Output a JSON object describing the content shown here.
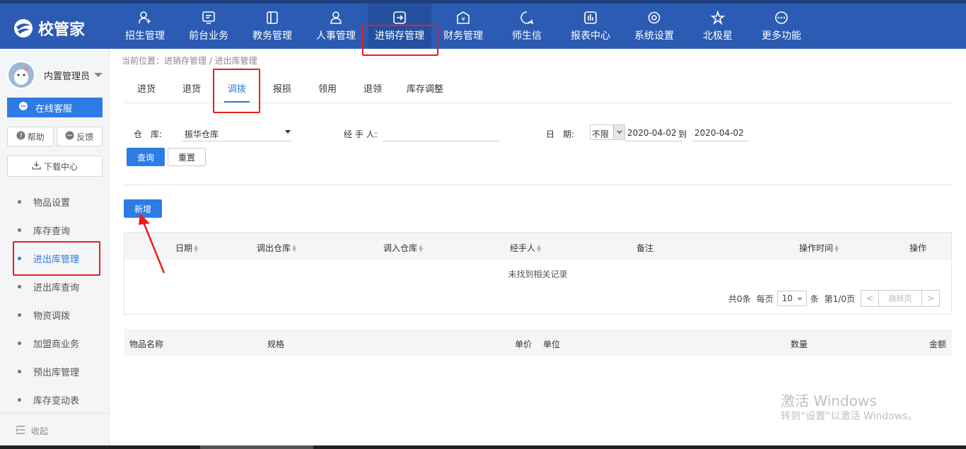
{
  "app": {
    "logo_text": "校管家"
  },
  "nav": [
    {
      "label": "招生管理",
      "icon": "person-add-icon"
    },
    {
      "label": "前台业务",
      "icon": "monitor-icon"
    },
    {
      "label": "教务管理",
      "icon": "book-icon"
    },
    {
      "label": "人事管理",
      "icon": "person-icon"
    },
    {
      "label": "进销存管理",
      "icon": "inventory-icon",
      "active": true
    },
    {
      "label": "财务管理",
      "icon": "yen-icon"
    },
    {
      "label": "师生信",
      "icon": "chat-icon"
    },
    {
      "label": "报表中心",
      "icon": "report-icon"
    },
    {
      "label": "系统设置",
      "icon": "settings-icon"
    },
    {
      "label": "北极星",
      "icon": "star-icon"
    },
    {
      "label": "更多功能",
      "icon": "more-icon"
    }
  ],
  "sidebar": {
    "user_name": "内置管理员",
    "online_service": "在线客服",
    "help": "帮助",
    "feedback": "反馈",
    "download_center": "下载中心",
    "items": [
      {
        "label": "物品设置"
      },
      {
        "label": "库存查询"
      },
      {
        "label": "进出库管理",
        "active": true
      },
      {
        "label": "进出库查询"
      },
      {
        "label": "物资调拨"
      },
      {
        "label": "加盟商业务"
      },
      {
        "label": "预出库管理"
      },
      {
        "label": "库存变动表"
      }
    ],
    "collapse": "收起"
  },
  "breadcrumb": "当前位置：进销存管理 / 进出库管理",
  "tabs": [
    {
      "label": "进货"
    },
    {
      "label": "退货"
    },
    {
      "label": "调拨",
      "active": true
    },
    {
      "label": "报损"
    },
    {
      "label": "领用"
    },
    {
      "label": "退领"
    },
    {
      "label": "库存调整"
    }
  ],
  "filter": {
    "warehouse_label": "仓　库:",
    "warehouse_value": "振华仓库",
    "handler_label": "经 手 人:",
    "handler_value": "",
    "date_label": "日　期:",
    "date_mode": "不限",
    "date_from": "2020-04-02",
    "date_to_sep": "到",
    "date_to": "2020-04-02",
    "query_btn": "查询",
    "reset_btn": "重置"
  },
  "add_btn": "新增",
  "table": {
    "columns": [
      "日期",
      "调出仓库",
      "调入仓库",
      "经手人",
      "备注",
      "操作时间",
      "操作"
    ],
    "empty_text": "未找到相关记录",
    "pager": {
      "total": "共0条",
      "per_page_label": "每页",
      "per_page": "10",
      "unit": "条",
      "page_info": "第1/0页",
      "jump": "跳转页",
      "prev": "<",
      "next": ">"
    }
  },
  "detail_columns": [
    "物品名称",
    "规格",
    "单价",
    "单位",
    "数量",
    "金额"
  ],
  "watermark": {
    "line1": "激活 Windows",
    "line2": "转到“设置”以激活 Windows。"
  },
  "colors": {
    "header": "#2b5bb2",
    "primary": "#2d7be5",
    "highlight": "#e81e1e"
  }
}
